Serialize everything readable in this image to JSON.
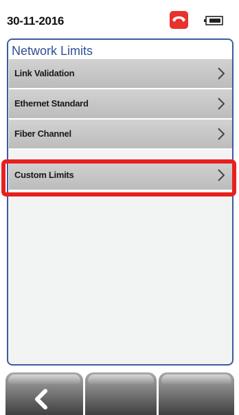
{
  "status_bar": {
    "date": "30-11-2016",
    "call_icon": "phone-hangup-icon",
    "battery_icon": "battery-icon"
  },
  "panel": {
    "title": "Network Limits",
    "items": [
      {
        "label": "Link Validation",
        "icon": "chevron-right-icon"
      },
      {
        "label": "Ethernet Standard",
        "icon": "chevron-right-icon"
      },
      {
        "label": "Fiber Channel",
        "icon": "chevron-right-icon"
      },
      {
        "label": "Custom Limits",
        "icon": "chevron-right-icon",
        "highlighted": true
      }
    ]
  },
  "bottom_bar": {
    "buttons": [
      {
        "icon": "back-arrow-icon"
      },
      {
        "icon": ""
      },
      {
        "icon": ""
      }
    ]
  },
  "colors": {
    "accent_blue": "#2f4f96",
    "highlight_red": "#e8201c",
    "call_red": "#e8322c",
    "menu_gray": "#c8c8c8"
  }
}
